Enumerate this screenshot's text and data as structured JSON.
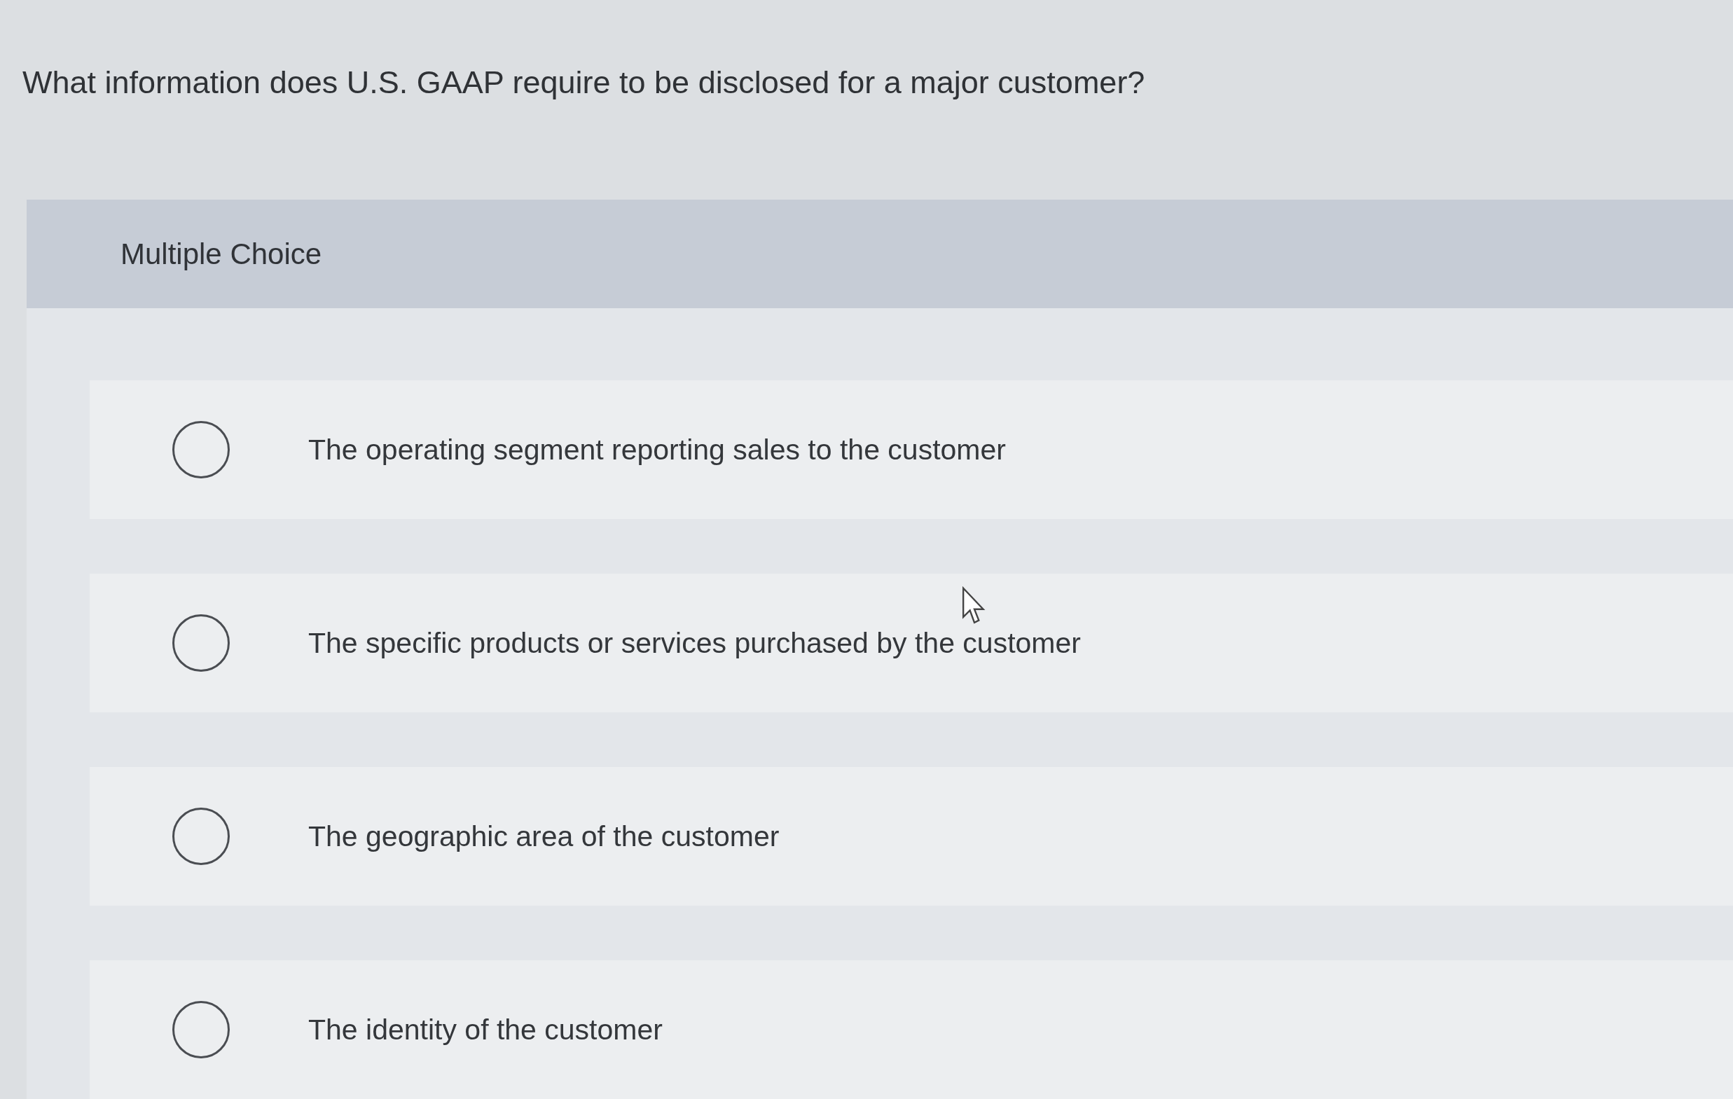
{
  "question": "What information does U.S. GAAP require to be disclosed for a major customer?",
  "section": {
    "label": "Multiple Choice"
  },
  "options": [
    {
      "label": "The operating segment reporting sales to the customer",
      "selected": false
    },
    {
      "label": "The specific products or services purchased by the customer",
      "selected": false
    },
    {
      "label": "The geographic area of the customer",
      "selected": false
    },
    {
      "label": "The identity of the customer",
      "selected": false
    }
  ]
}
